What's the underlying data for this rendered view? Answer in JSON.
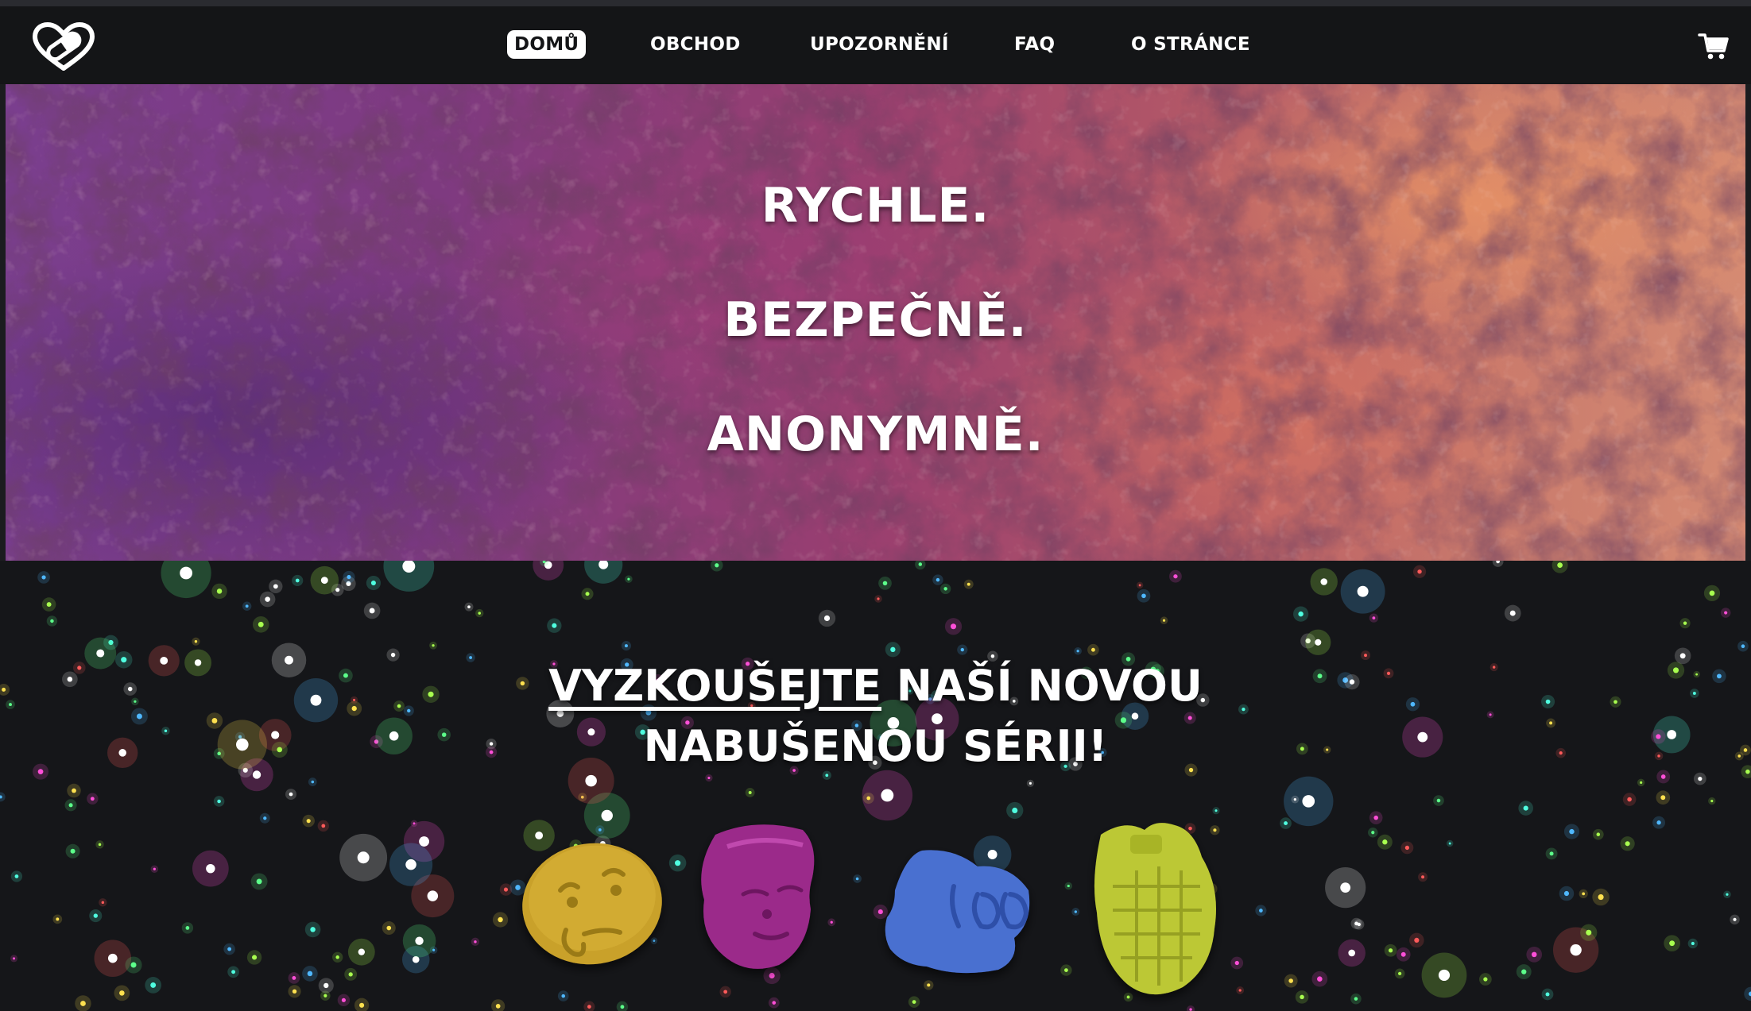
{
  "nav": {
    "logo_icon": "heart-pill-logo-icon",
    "items": [
      {
        "label": "DOMŮ",
        "active": true
      },
      {
        "label": "OBCHOD",
        "active": false
      },
      {
        "label": "UPOZORNĚNÍ",
        "active": false
      },
      {
        "label": "FAQ",
        "active": false
      },
      {
        "label": "O STRÁNCE",
        "active": false
      }
    ],
    "cart_icon": "shopping-cart-icon"
  },
  "hero": {
    "lines": [
      "RYCHLE.",
      "BEZPEČNĚ.",
      "ANONYMNĚ."
    ]
  },
  "promo": {
    "link_text": "VYZKOUŠEJTE",
    "title_rest_line1": " NAŠÍ NOVOU",
    "title_line2": "NABUŠENOU SÉRII!",
    "products": [
      {
        "name": "thinking-emoji-pill",
        "color": "#c9a12a"
      },
      {
        "name": "face-pill",
        "color": "#9b2a8a"
      },
      {
        "name": "blue-pill",
        "color": "#4a6fd0"
      },
      {
        "name": "grenade-pill",
        "color": "#bcc834"
      }
    ]
  },
  "colors": {
    "navbar": "#141517",
    "background": "#151619",
    "text": "#ffffff"
  }
}
